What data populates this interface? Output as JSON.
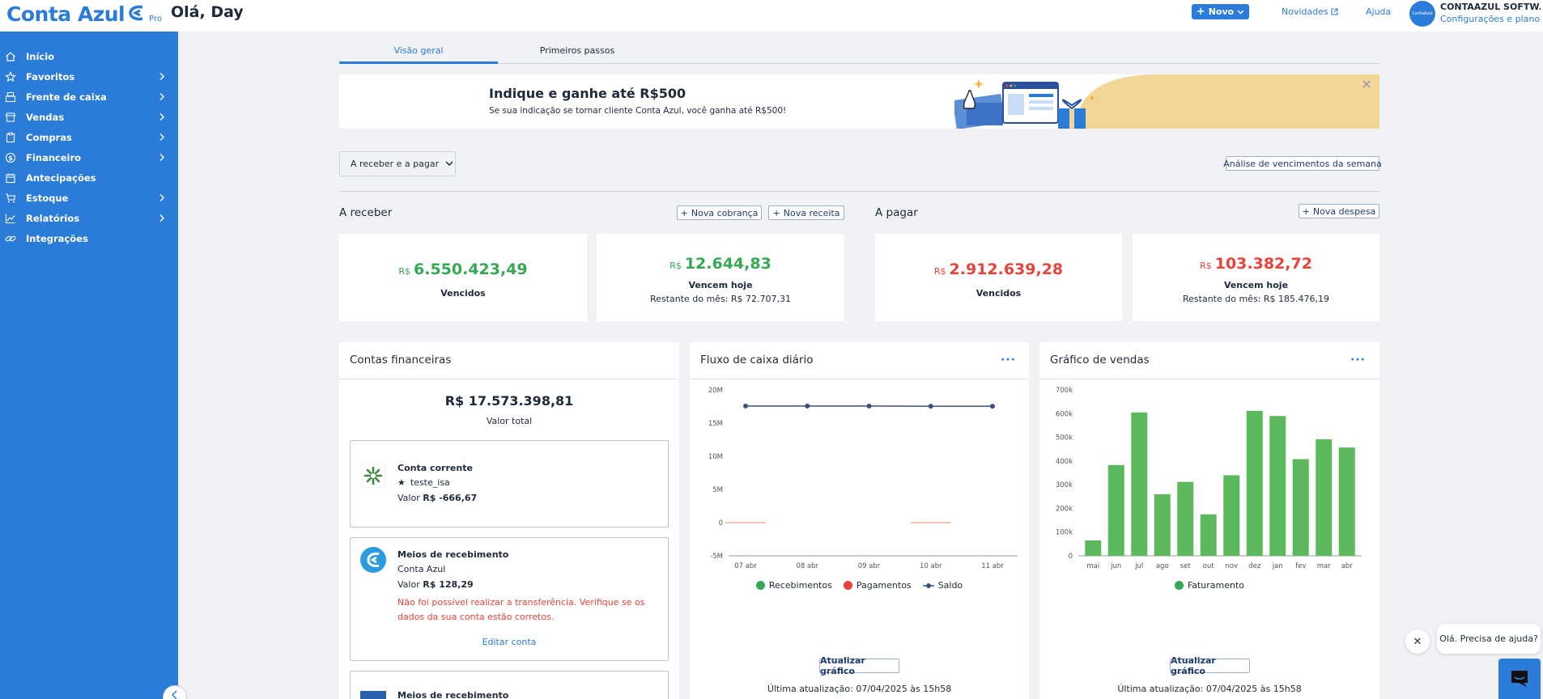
{
  "header": {
    "logo_text": "Conta Azul",
    "plan": "Pro",
    "greeting": "Olá, Day",
    "new_button": "Novo",
    "news_link": "Novidades",
    "help_link": "Ajuda",
    "avatar_text": "ContaAzul",
    "company_name": "CONTAAZUL SOFTW...",
    "company_sub": "Configurações e plano"
  },
  "sidebar": {
    "items": [
      {
        "label": "Início",
        "icon": "home-icon",
        "has_children": false
      },
      {
        "label": "Favoritos",
        "icon": "star-icon",
        "has_children": true
      },
      {
        "label": "Frente de caixa",
        "icon": "register-icon",
        "has_children": true
      },
      {
        "label": "Vendas",
        "icon": "store-icon",
        "has_children": true
      },
      {
        "label": "Compras",
        "icon": "clipboard-icon",
        "has_children": true
      },
      {
        "label": "Financeiro",
        "icon": "dollar-icon",
        "has_children": true
      },
      {
        "label": "Antecipações",
        "icon": "calendar-icon",
        "has_children": false
      },
      {
        "label": "Estoque",
        "icon": "cart-icon",
        "has_children": true
      },
      {
        "label": "Relatórios",
        "icon": "chart-line-icon",
        "has_children": true
      },
      {
        "label": "Integrações",
        "icon": "link-icon",
        "has_children": false
      }
    ]
  },
  "tabs": [
    {
      "label": "Visão geral",
      "active": true
    },
    {
      "label": "Primeiros passos",
      "active": false
    }
  ],
  "banner": {
    "title": "Indique e ganhe até R$500",
    "subtitle": "Se sua indicação se tornar cliente Conta Azul, você ganha até R$500!"
  },
  "filter": {
    "dropdown": "A receber e a pagar",
    "analysis_button": "Análise de vencimentos da semana"
  },
  "receivable": {
    "title": "A receber",
    "new_charge": "Nova cobrança",
    "new_revenue": "Nova receita",
    "overdue": {
      "currency": "R$",
      "amount": "6.550.423,49",
      "label": "Vencidos"
    },
    "today": {
      "currency": "R$",
      "amount": "12.644,83",
      "label": "Vencem hoje",
      "sub": "Restante do mês: R$ 72.707,31"
    }
  },
  "payable": {
    "title": "A pagar",
    "new_expense": "Nova despesa",
    "overdue": {
      "currency": "R$",
      "amount": "2.912.639,28",
      "label": "Vencidos"
    },
    "today": {
      "currency": "R$",
      "amount": "103.382,72",
      "label": "Vencem hoje",
      "sub": "Restante do mês: R$ 185.476,19"
    }
  },
  "accounts": {
    "title": "Contas financeiras",
    "total": "R$ 17.573.398,81",
    "total_label": "Valor total",
    "cards": [
      {
        "title": "Conta corrente",
        "name": "teste_isa",
        "value_label": "Valor",
        "value": "R$ -666,67"
      },
      {
        "title": "Meios de recebimento",
        "name": "Conta Azul",
        "value_label": "Valor",
        "value": "R$ 128,29",
        "error": "Não foi possível realizar a transferência. Verifique se os dados da sua conta estão corretos.",
        "link": "Editar conta"
      },
      {
        "title": "Meios de recebimento"
      }
    ]
  },
  "cashflow": {
    "title": "Fluxo de caixa diário",
    "menu": "···",
    "update_button": "Atualizar gráfico",
    "updated_text": "Última atualização: 07/04/2025 às 15h58"
  },
  "sales": {
    "title": "Gráfico de vendas",
    "menu": "···",
    "update_button": "Atualizar gráfico",
    "updated_text": "Última atualização: 07/04/2025 às 15h58"
  },
  "chart_data": [
    {
      "type": "line",
      "title": "Fluxo de caixa diário",
      "categories": [
        "07 abr",
        "08 abr",
        "09 abr",
        "10 abr",
        "11 abr"
      ],
      "y_ticks": [
        "20M",
        "15M",
        "10M",
        "5M",
        "0",
        "-5M"
      ],
      "ylim": [
        -5000000,
        20000000
      ],
      "series": [
        {
          "name": "Recebimentos",
          "type": "bar",
          "color": "#34a853",
          "values": [
            0,
            0,
            0,
            0,
            0
          ]
        },
        {
          "name": "Pagamentos",
          "type": "bar",
          "color": "#e8433a",
          "values": [
            0,
            0,
            0,
            0,
            0
          ]
        },
        {
          "name": "Saldo",
          "type": "line",
          "color": "#3a4f7a",
          "values": [
            17580000,
            17580000,
            17570000,
            17540000,
            17540000
          ]
        }
      ]
    },
    {
      "type": "bar",
      "title": "Gráfico de vendas",
      "categories": [
        "mai",
        "jun",
        "jul",
        "ago",
        "set",
        "out",
        "nov",
        "dez",
        "jan",
        "fev",
        "mar",
        "abr"
      ],
      "y_ticks": [
        "700k",
        "600k",
        "500k",
        "400k",
        "300k",
        "200k",
        "100k",
        "0"
      ],
      "ylim": [
        0,
        700000
      ],
      "series": [
        {
          "name": "Faturamento",
          "color": "#5cb85c",
          "values": [
            65000,
            383000,
            605000,
            260000,
            312000,
            175000,
            340000,
            612000,
            590000,
            408000,
            492000,
            457000
          ]
        }
      ]
    }
  ],
  "chat": {
    "bubble": "Olá. Precisa de ajuda?",
    "close": "✕"
  }
}
